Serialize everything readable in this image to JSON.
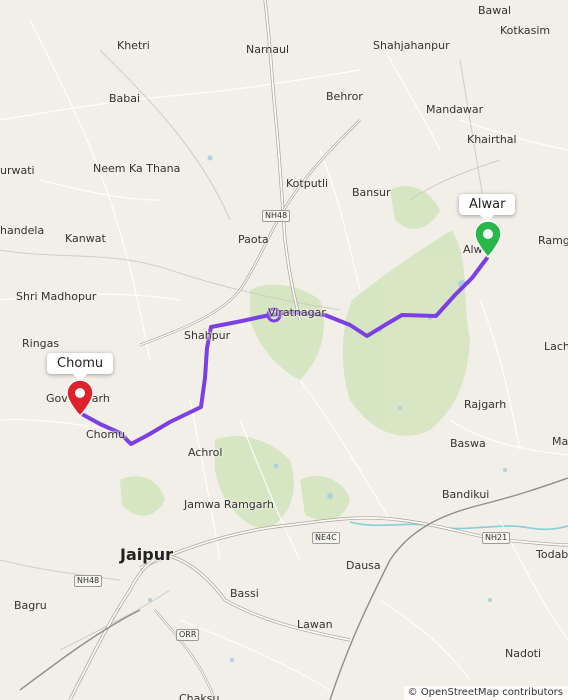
{
  "places": [
    {
      "name": "Narnaul"
    },
    {
      "name": "Bawal"
    },
    {
      "name": "Kotkasim"
    },
    {
      "name": "Khetri"
    },
    {
      "name": "Shahjahanpur"
    },
    {
      "name": "Behror"
    },
    {
      "name": "Mandawar"
    },
    {
      "name": "Babai"
    },
    {
      "name": "Khairthal"
    },
    {
      "name": "urwati"
    },
    {
      "name": "Neem Ka Thana"
    },
    {
      "name": "Kotputli"
    },
    {
      "name": "Bansur"
    },
    {
      "name": "handela"
    },
    {
      "name": "Kanwat"
    },
    {
      "name": "Paota"
    },
    {
      "name": "Ramg"
    },
    {
      "name": "Alwar"
    },
    {
      "name": "Shri Madhopur"
    },
    {
      "name": "Viratnagar"
    },
    {
      "name": "Shahpur"
    },
    {
      "name": "Lachh"
    },
    {
      "name": "Ringas"
    },
    {
      "name": "Govindgarh"
    },
    {
      "name": "Rajgarh"
    },
    {
      "name": "Chomu"
    },
    {
      "name": "Achrol"
    },
    {
      "name": "Baswa"
    },
    {
      "name": "Ma"
    },
    {
      "name": "Bandikui"
    },
    {
      "name": "Jamwa Ramgarh"
    },
    {
      "name": "Jaipur"
    },
    {
      "name": "Dausa"
    },
    {
      "name": "Todab"
    },
    {
      "name": "Bagru"
    },
    {
      "name": "Bassi"
    },
    {
      "name": "Lawan"
    },
    {
      "name": "Nadoti"
    },
    {
      "name": "Chaksu"
    }
  ],
  "road_shields": [
    "NH48",
    "NE4C",
    "NH21",
    "NH48",
    "ORR"
  ],
  "markers": {
    "origin": {
      "label": "Chomu",
      "color": "#e0212c"
    },
    "destination": {
      "label": "Alwar",
      "color": "#2ab749"
    }
  },
  "route_color": "#7b3fe4",
  "attribution": {
    "symbol": "©",
    "text": "OpenStreetMap contributors"
  }
}
